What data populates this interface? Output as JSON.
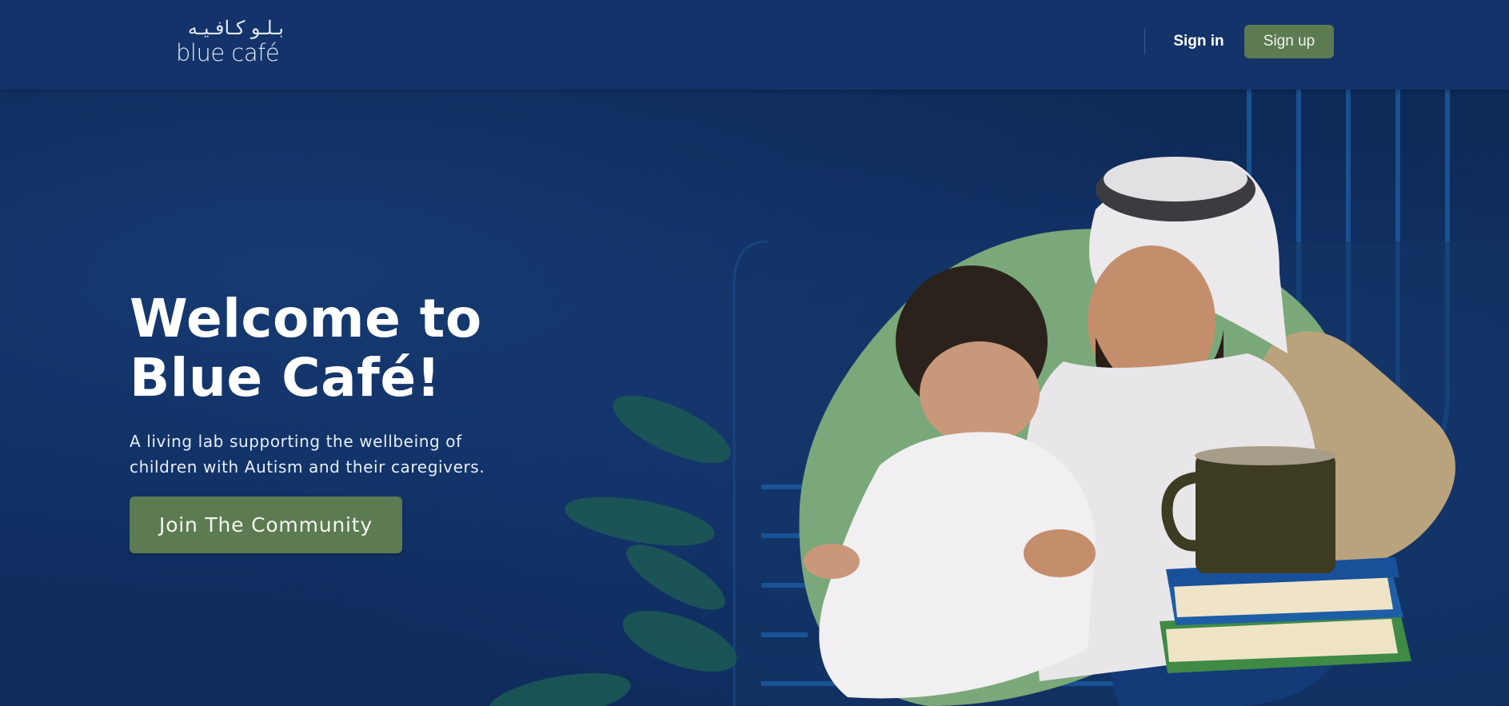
{
  "header": {
    "logo_arabic": "بـلـو كـافـيـه",
    "logo_english": "blue café",
    "signin_label": "Sign in",
    "signup_label": "Sign up"
  },
  "hero": {
    "title_line1": "Welcome to",
    "title_line2": "Blue Café!",
    "subtitle_line1": "A living lab supporting the wellbeing of",
    "subtitle_line2": "children with Autism and their caregivers.",
    "cta_label": "Join The Community"
  },
  "colors": {
    "header_bg": "#13336a",
    "hero_bg": "#0f2c5c",
    "accent_green": "#5c7b52",
    "blob_green": "#7aa87a",
    "blob_tan": "#b9a37c"
  }
}
